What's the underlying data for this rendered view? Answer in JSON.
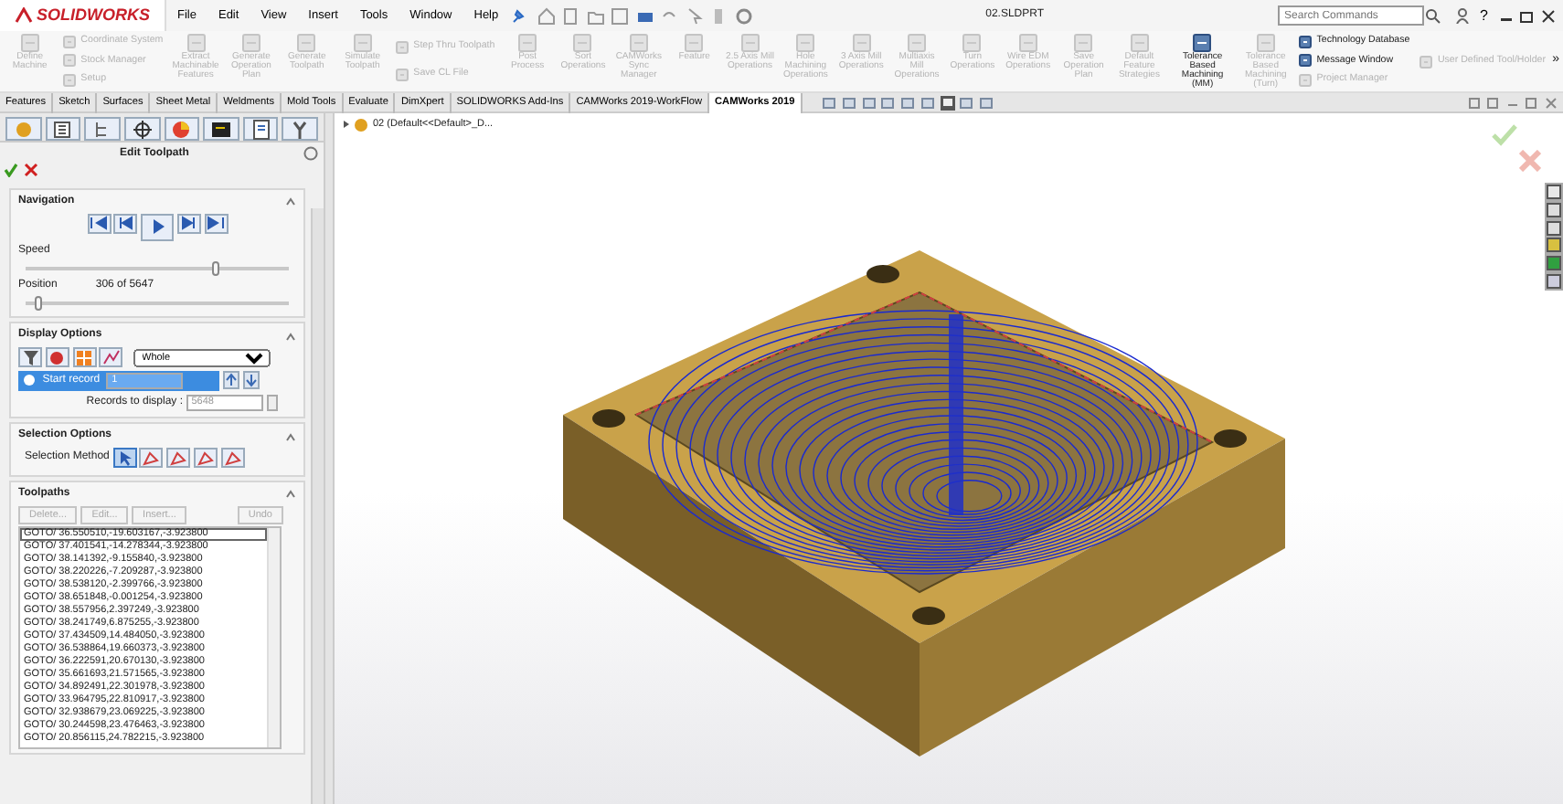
{
  "title_bar": {
    "app_name": "SOLIDWORKS",
    "menus": [
      "File",
      "Edit",
      "View",
      "Insert",
      "Tools",
      "Window",
      "Help"
    ],
    "document_title": "02.SLDPRT",
    "search": {
      "placeholder": "Search Commands"
    },
    "help": "?"
  },
  "ribbon": [
    {
      "kind": "large",
      "label": "Define Machine",
      "disabled": true
    },
    {
      "kind": "stack",
      "items": [
        {
          "label": "Coordinate System",
          "disabled": true
        },
        {
          "label": "Stock Manager",
          "disabled": true
        },
        {
          "label": "Setup",
          "disabled": true
        }
      ]
    },
    {
      "kind": "large",
      "label": "Extract Machinable Features",
      "disabled": true
    },
    {
      "kind": "large",
      "label": "Generate Operation Plan",
      "disabled": true
    },
    {
      "kind": "large",
      "label": "Generate Toolpath",
      "disabled": true
    },
    {
      "kind": "large",
      "label": "Simulate Toolpath",
      "disabled": true
    },
    {
      "kind": "stack",
      "items": [
        {
          "label": "Step Thru Toolpath",
          "disabled": true
        },
        {
          "label": "Save CL File",
          "disabled": true
        }
      ]
    },
    {
      "kind": "large",
      "label": "Post Process",
      "disabled": true
    },
    {
      "kind": "large",
      "label": "Sort Operations",
      "disabled": true
    },
    {
      "kind": "large",
      "label": "CAMWorks Sync Manager",
      "disabled": true
    },
    {
      "kind": "large",
      "label": "Feature",
      "disabled": true
    },
    {
      "kind": "large",
      "label": "2.5 Axis Mill Operations",
      "disabled": true
    },
    {
      "kind": "large",
      "label": "Hole Machining Operations",
      "disabled": true
    },
    {
      "kind": "large",
      "label": "3 Axis Mill Operations",
      "disabled": true
    },
    {
      "kind": "large",
      "label": "Multiaxis Mill Operations",
      "disabled": true
    },
    {
      "kind": "large",
      "label": "Turn Operations",
      "disabled": true
    },
    {
      "kind": "large",
      "label": "Wire EDM Operations",
      "disabled": true
    },
    {
      "kind": "large",
      "label": "Save Operation Plan",
      "disabled": true
    },
    {
      "kind": "large",
      "label": "Default Feature Strategies",
      "disabled": true
    },
    {
      "kind": "large",
      "label": "Tolerance Based Machining (MM)",
      "disabled": false
    },
    {
      "kind": "large",
      "label": "Tolerance Based Machining (Turn)",
      "disabled": true
    },
    {
      "kind": "stack",
      "items": [
        {
          "label": "Technology Database",
          "disabled": false
        },
        {
          "label": "Message Window",
          "disabled": false
        },
        {
          "label": "Project Manager",
          "disabled": true
        }
      ]
    },
    {
      "kind": "stack",
      "items": [
        {
          "label": "User Defined Tool/Holder",
          "disabled": true
        }
      ]
    }
  ],
  "ribbon_overflow": "»",
  "tabs": [
    {
      "label": "Features",
      "selected": false
    },
    {
      "label": "Sketch",
      "selected": false
    },
    {
      "label": "Surfaces",
      "selected": false
    },
    {
      "label": "Sheet Metal",
      "selected": false
    },
    {
      "label": "Weldments",
      "selected": false
    },
    {
      "label": "Mold Tools",
      "selected": false
    },
    {
      "label": "Evaluate",
      "selected": false
    },
    {
      "label": "DimXpert",
      "selected": false
    },
    {
      "label": "SOLIDWORKS Add-Ins",
      "selected": false
    },
    {
      "label": "CAMWorks 2019-WorkFlow",
      "selected": false
    },
    {
      "label": "CAMWorks 2019",
      "selected": true
    }
  ],
  "property_manager": {
    "title": "Edit Toolpath",
    "navigation": {
      "title": "Navigation",
      "speed": {
        "label": "Speed",
        "level": 0.72
      },
      "position": {
        "label": "Position",
        "reading": "306 of 5647",
        "level": 0.05
      }
    },
    "display_options": {
      "title": "Display Options",
      "mode": "Whole",
      "start_record": {
        "label": "Start record",
        "value": "1"
      },
      "records_to_display": {
        "label": "Records to display :",
        "value": "5648"
      }
    },
    "selection_options": {
      "title": "Selection Options",
      "label": "Selection Method",
      "methods": [
        {
          "selected": true
        },
        {
          "selected": false
        },
        {
          "selected": false
        },
        {
          "selected": false
        },
        {
          "selected": false
        }
      ]
    },
    "toolpaths": {
      "title": "Toolpaths",
      "buttons": [
        {
          "label": "Delete...",
          "disabled": true
        },
        {
          "label": "Edit...",
          "disabled": true
        },
        {
          "label": "Insert...",
          "disabled": true
        },
        {
          "label": "Undo",
          "disabled": true
        }
      ],
      "records": [
        {
          "text": "GOTO/ 36.550510,-19.603167,-3.923800",
          "selected": true
        },
        {
          "text": "GOTO/ 37.401541,-14.278344,-3.923800",
          "selected": false
        },
        {
          "text": "GOTO/ 38.141392,-9.155840,-3.923800",
          "selected": false
        },
        {
          "text": "GOTO/ 38.220226,-7.209287,-3.923800",
          "selected": false
        },
        {
          "text": "GOTO/ 38.538120,-2.399766,-3.923800",
          "selected": false
        },
        {
          "text": "GOTO/ 38.651848,-0.001254,-3.923800",
          "selected": false
        },
        {
          "text": "GOTO/ 38.557956,2.397249,-3.923800",
          "selected": false
        },
        {
          "text": "GOTO/ 38.241749,6.875255,-3.923800",
          "selected": false
        },
        {
          "text": "GOTO/ 37.434509,14.484050,-3.923800",
          "selected": false
        },
        {
          "text": "GOTO/ 36.538864,19.660373,-3.923800",
          "selected": false
        },
        {
          "text": "GOTO/ 36.222591,20.670130,-3.923800",
          "selected": false
        },
        {
          "text": "GOTO/ 35.661693,21.571565,-3.923800",
          "selected": false
        },
        {
          "text": "GOTO/ 34.892491,22.301978,-3.923800",
          "selected": false
        },
        {
          "text": "GOTO/ 33.964795,22.810917,-3.923800",
          "selected": false
        },
        {
          "text": "GOTO/ 32.938679,23.069225,-3.923800",
          "selected": false
        },
        {
          "text": "GOTO/ 30.244598,23.476463,-3.923800",
          "selected": false
        },
        {
          "text": "GOTO/ 20.856115,24.782215,-3.923800",
          "selected": false
        }
      ]
    }
  },
  "feature_tree": {
    "label": "02 (Default<<Default>_D..."
  }
}
